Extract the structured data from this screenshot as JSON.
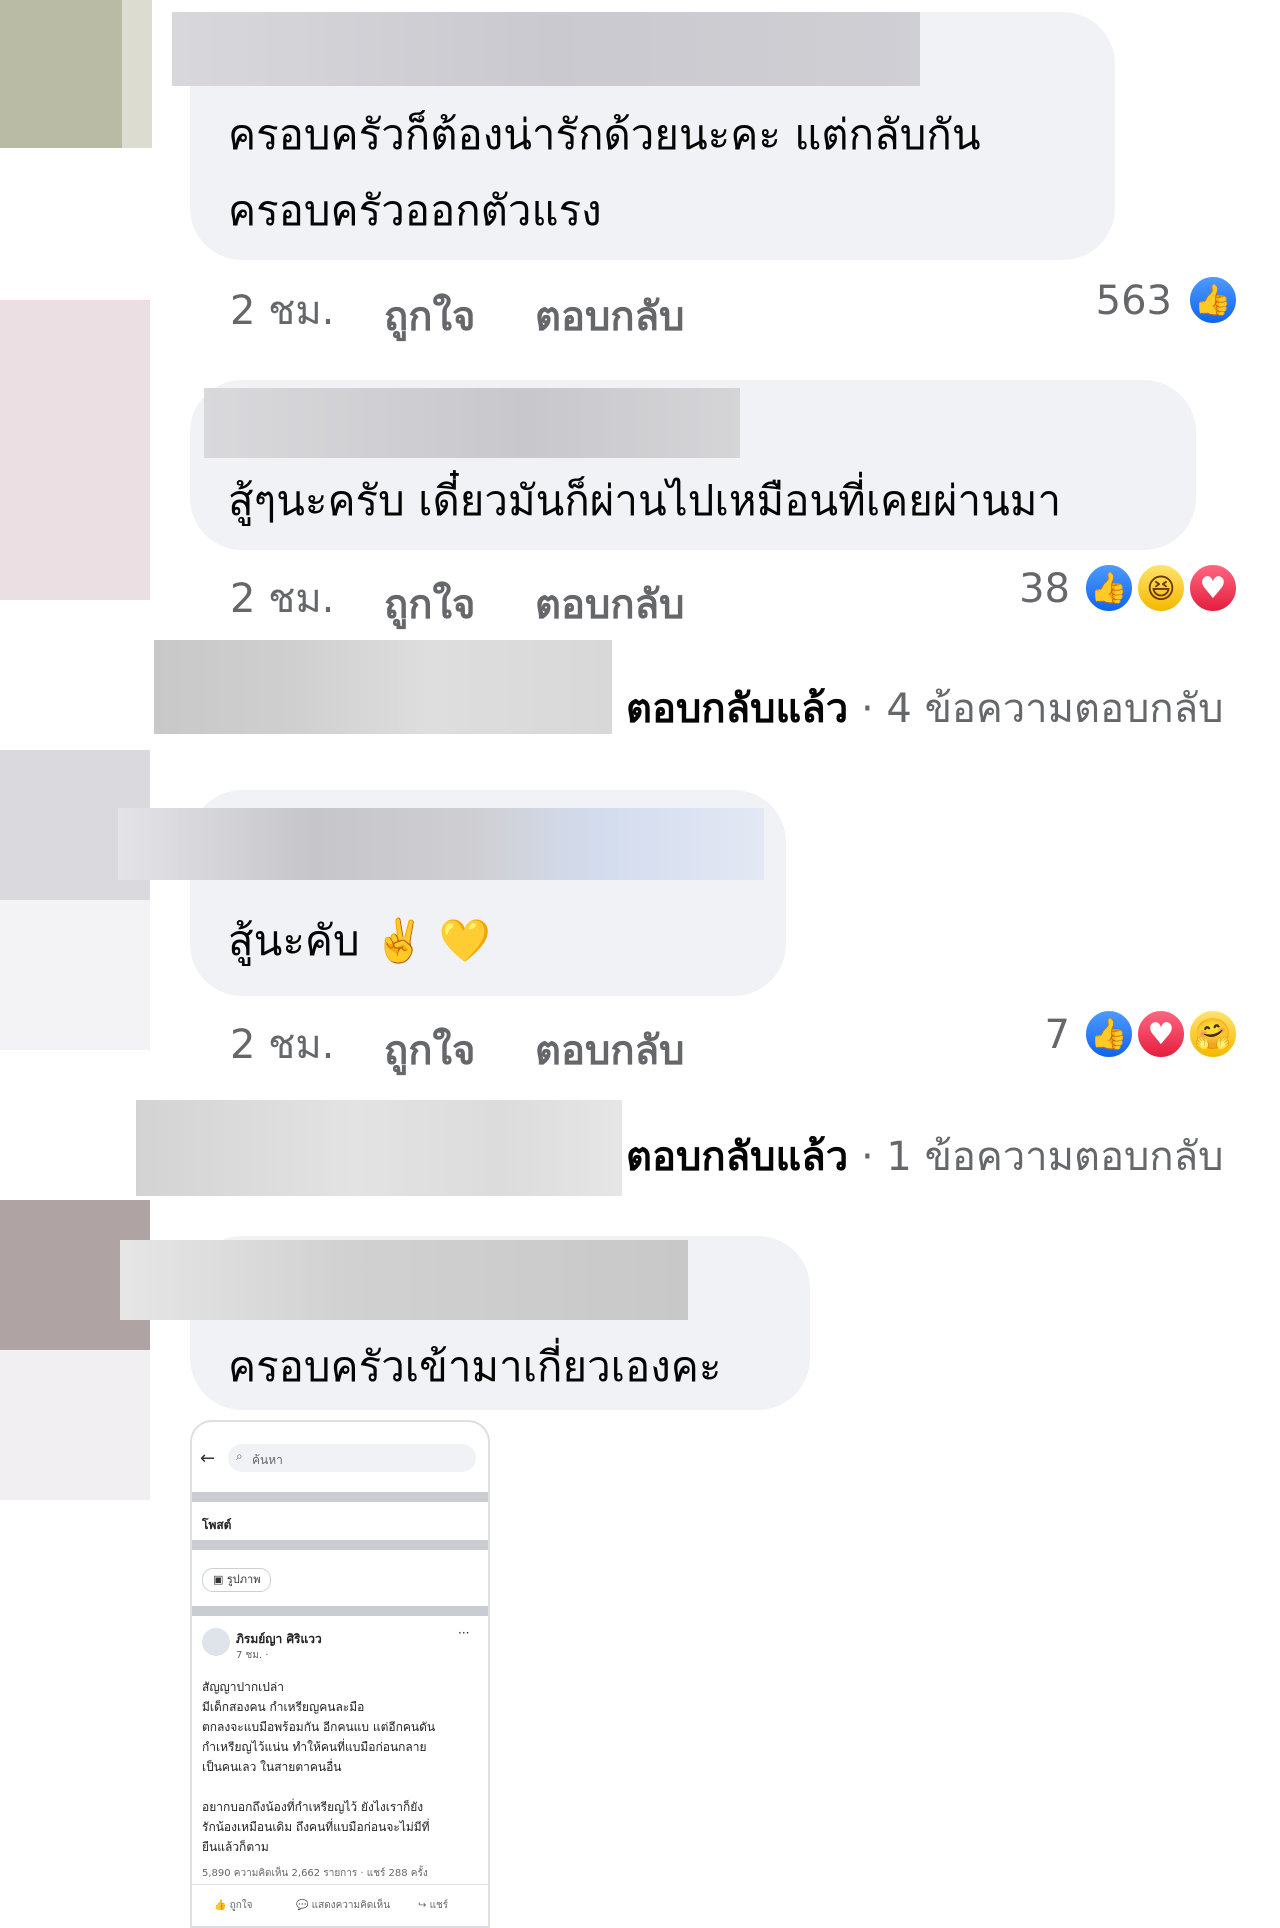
{
  "comments": [
    {
      "lines": [
        "ครอบครัวก็ต้องน่ารักด้วยนะคะ  แต่กลับกัน",
        "ครอบครัวออกตัวแรง"
      ],
      "time": "2 ชม.",
      "like_label": "ถูกใจ",
      "reply_label": "ตอบกลับ",
      "reaction_count": "563",
      "reactions": [
        "like"
      ]
    },
    {
      "lines": [
        "สู้ๆนะครับ เดี๋ยวมันก็ผ่านไปเหมือนที่เคยผ่านมา"
      ],
      "time": "2 ชม.",
      "like_label": "ถูกใจ",
      "reply_label": "ตอบกลับ",
      "reaction_count": "38",
      "reactions": [
        "like",
        "haha",
        "love"
      ],
      "replies_summary": "ตอบกลับแล้ว · 4 ข้อความตอบกลับ"
    },
    {
      "lines": [
        "สู้นะคับ ✌️ 💛"
      ],
      "time": "2 ชม.",
      "like_label": "ถูกใจ",
      "reply_label": "ตอบกลับ",
      "reaction_count": "7",
      "reactions": [
        "like",
        "love",
        "care"
      ],
      "replies_summary": "ตอบกลับแล้ว · 1 ข้อความตอบกลับ"
    },
    {
      "lines": [
        "ครอบครัวเข้ามาเกี่ยวเองคะ"
      ]
    }
  ],
  "attachment": {
    "search_placeholder": "ค้นหา",
    "section_title": "โพสต์",
    "filter_chip": "รูปภาพ",
    "author": "ภิรมย์ญา ศิริแวว",
    "post_time": "7 ชม. · ",
    "post_lines": [
      "สัญญาปากเปล่า",
      "มีเด็กสองคน กำเหรียญคนละมือ",
      "ตกลงจะแบมือพร้อมกัน อีกคนแบ แต่อีกคนดัน",
      "กำเหรียญไว้แน่น ทำให้คนที่แบมือก่อนกลาย",
      "เป็นคนเลว ในสายตาคนอื่น",
      "",
      "อยากบอกถึงน้องที่กำเหรียญไว้ ยังไงเราก็ยัง",
      "รักน้องเหมือนเดิม ถึงคนที่แบมือก่อนจะไม่มีที่",
      "ยืนแล้วก็ตาม"
    ],
    "stats": "5,890    ความคิดเห็น 2,662 รายการ · แชร์ 288 ครั้ง",
    "actions": [
      "ถูกใจ",
      "แสดงความคิดเห็น",
      "แชร์"
    ]
  }
}
